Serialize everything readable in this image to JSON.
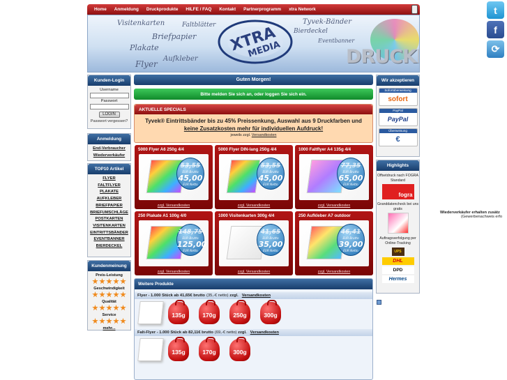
{
  "nav": {
    "items": [
      "Home",
      "Anmeldung",
      "Druckprodukte",
      "HILFE / FAQ",
      "Kontakt",
      "Partnerprogramm",
      "xtra Network"
    ]
  },
  "banner": {
    "words": [
      "Visitenkarten",
      "Faltblätter",
      "Briefpapier",
      "Plakate",
      "Aufkleber",
      "Flyer",
      "Tyvek-Bänder",
      "Bierdeckel",
      "Eventbanner",
      "DRUCKEN"
    ],
    "logo_top": "XTRA",
    "logo_bottom": "MEDIA"
  },
  "login": {
    "title": "Kunden-Login",
    "user_label": "Username",
    "pass_label": "Passwort",
    "button": "LOGIN",
    "forgot": "Passwort vergessen?"
  },
  "registration": {
    "title": "Anmeldung",
    "links": [
      "End-Verbraucher",
      "Wiederverkäufer"
    ]
  },
  "top10": {
    "title": "TOP10 Artikel",
    "links": [
      "FLYER",
      "FALTFLYER",
      "PLAKATE",
      "AUFKLEBER",
      "BRIEFPAPIER",
      "BRIEFUMSCHLÄGE",
      "POSTKARTEN",
      "VISITENKARTEN",
      "EINTRITTSBÄNDER",
      "EVENTBANNER",
      "BIERDECKEL"
    ]
  },
  "rating": {
    "title": "Kundenmeinung",
    "items": [
      "Preis-Leistung",
      "Geschwindigkeit",
      "Qualität",
      "Service"
    ],
    "more": "mehr..."
  },
  "greeting": "Guten Morgen!",
  "login_notice": "Bitte melden Sie sich an, oder loggen Sie sich ein.",
  "specials": {
    "title": "AKTUELLE SPECIALS",
    "line1": "Tyvek® Eintrittsbänder bis zu 45% Preissenkung, Auswahl aus 9 Druckfarben und",
    "line2": "keine Zusatzkosten mehr für individuellen Aufdruck!",
    "note_prefix": "jeweils zzgl.",
    "note_link": "Versandkosten"
  },
  "products": [
    {
      "title": "5000 Flyer A6 250g 4/4",
      "old": "53,55",
      "new": "45,00",
      "ship": "zzgl. Versandkosten"
    },
    {
      "title": "5000 Flyer DIN-lang 250g 4/4",
      "old": "53,55",
      "new": "45,00",
      "ship": "zzgl. Versandkosten"
    },
    {
      "title": "1000 Faltflyer A4 135g 4/4",
      "old": "77,35",
      "new": "65,00",
      "ship": "zzgl. Versandkosten"
    },
    {
      "title": "250 Plakate A1 100g 4/0",
      "old": "148,75",
      "new": "125,00",
      "ship": "zzgl. Versandkosten"
    },
    {
      "title": "1000 Visitenkarten 300g 4/4",
      "old": "41,65",
      "new": "35,00",
      "ship": "zzgl. Versandkosten"
    },
    {
      "title": "250 Aufkleber A7 outdoor",
      "old": "46,41",
      "new": "39,00",
      "ship": "zzgl. Versandkosten"
    }
  ],
  "badge_gross": "EUR Brutto",
  "badge_net": "EUR Netto",
  "more_products": {
    "title": "Weitere Produkte",
    "rows": [
      {
        "label": "Flyer - 1.000 Stück ab 41,65€ brutto",
        "net": "(35,-€ netto)",
        "ship_prefix": "zzgl.",
        "ship_link": "Versandkosten",
        "weights": [
          "135g",
          "170g",
          "250g",
          "300g"
        ]
      },
      {
        "label": "Falt-Flyer - 1.000 Stück ab 82,11€ brutto",
        "net": "(69,-€ netto)",
        "ship_prefix": "zzgl.",
        "ship_link": "Versandkosten",
        "weights": [
          "135g",
          "170g",
          "300g"
        ]
      }
    ]
  },
  "payment": {
    "title": "Wir akzeptieren",
    "methods": [
      {
        "cap": "Sofortüberweisung",
        "name": "sofort"
      },
      {
        "cap": "PayPal",
        "name": "PayPal"
      },
      {
        "cap": "Überweisung",
        "name": "€"
      }
    ]
  },
  "highlights": {
    "title": "Highlights",
    "items": [
      "Offsetdruck nach FOGRA Standard",
      "Granddatencheck bei uns gratis",
      "Auftragsverfolgung per Online-Tracking"
    ],
    "carriers": [
      "UPS",
      "DHL",
      "DPD",
      "Hermes"
    ],
    "fogra": "fogra"
  },
  "side_note": {
    "line1": "Wiederverkäufer erhalten zusätz",
    "line2": "(Gewerbenachweis erfo"
  },
  "colors": {
    "nav_red": "#b51e1e",
    "panel_blue": "#1f4a80",
    "green": "#1ea33d",
    "star": "#f08a1c"
  }
}
